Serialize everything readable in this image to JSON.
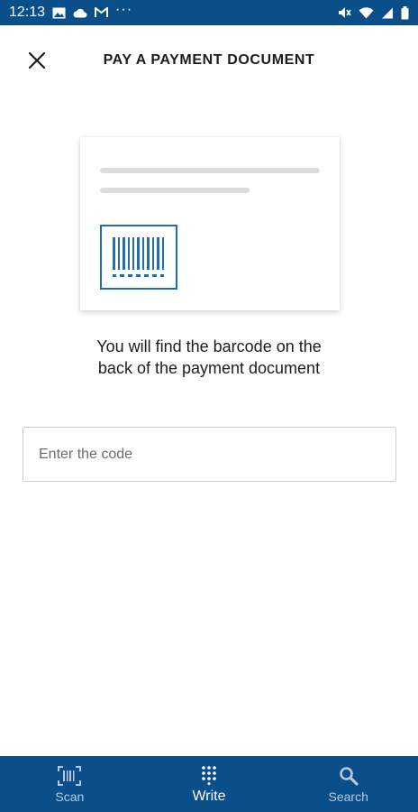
{
  "status_bar": {
    "time": "12:13",
    "left_icons": [
      "image-icon",
      "cloud-icon",
      "gmail-icon",
      "more-dots-icon"
    ],
    "more_dots": "···",
    "right_icons": [
      "mute-icon",
      "wifi-icon",
      "signal-icon",
      "battery-icon"
    ]
  },
  "header": {
    "title": "PAY A PAYMENT DOCUMENT",
    "close_icon": "close-icon"
  },
  "illustration": {
    "icon": "barcode-icon",
    "accent_color": "#1f6fb0"
  },
  "hint": {
    "line1": "You will find the barcode on the",
    "line2": "back of the payment document"
  },
  "code_input": {
    "value": "",
    "placeholder": "Enter the code"
  },
  "bottom_nav": {
    "items": [
      {
        "label": "Scan",
        "icon": "scan-icon",
        "active": false
      },
      {
        "label": "Write",
        "icon": "keypad-icon",
        "active": true
      },
      {
        "label": "Search",
        "icon": "search-icon",
        "active": false
      }
    ]
  },
  "colors": {
    "brand": "#0a4f8a",
    "accent": "#1f6fb0",
    "text": "#1c1c1c"
  }
}
